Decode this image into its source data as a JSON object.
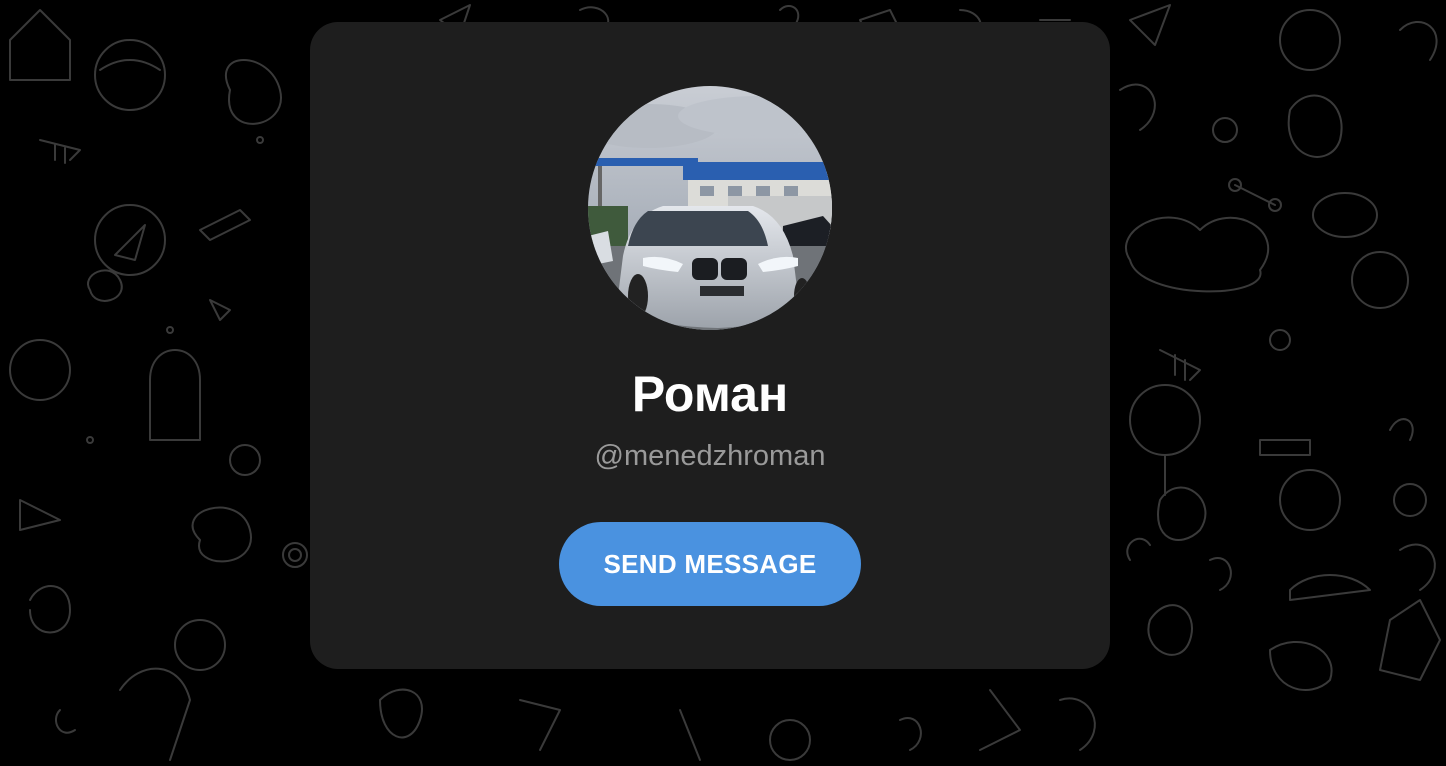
{
  "profile": {
    "name": "Роман",
    "username": "@menedzhroman",
    "avatar_icon": "profile-photo-car"
  },
  "actions": {
    "send_label": "SEND MESSAGE"
  },
  "colors": {
    "background": "#000000",
    "card": "#1e1e1e",
    "accent": "#4a92e0",
    "muted_text": "#9a9a9a"
  }
}
